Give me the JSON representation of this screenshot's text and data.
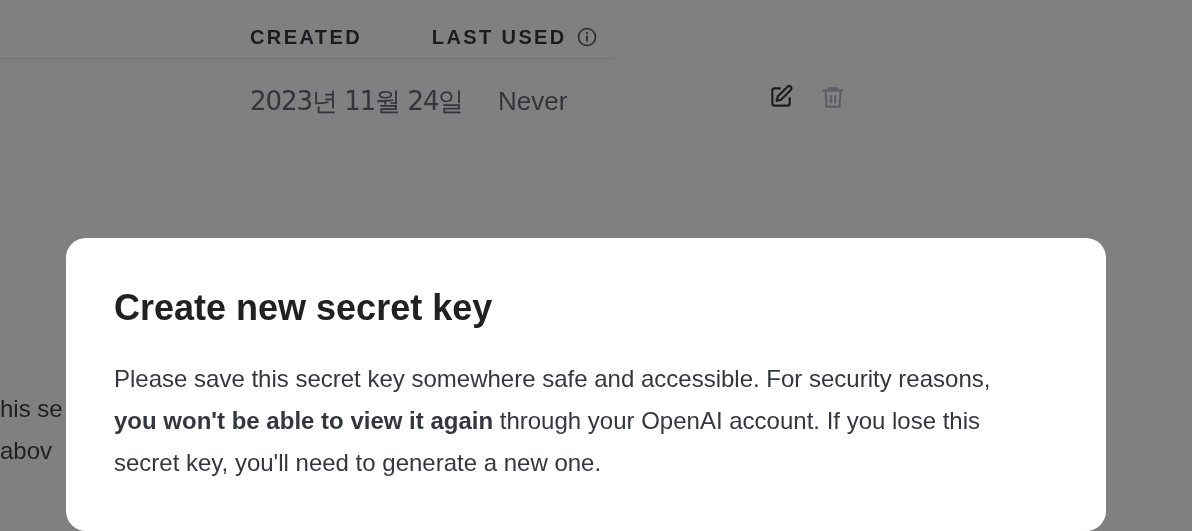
{
  "table": {
    "columns": [
      {
        "label": "CREATED",
        "info": false
      },
      {
        "label": "LAST USED",
        "info": true
      }
    ],
    "rows": [
      {
        "created": "2023년 11월 24일",
        "last_used": "Never"
      }
    ]
  },
  "background_text": [
    "his se",
    "abov"
  ],
  "modal": {
    "title": "Create new secret key",
    "message": "Please save this secret key somewhere safe and accessible. For security reasons, **you won't be able to view it again** through your OpenAI account. If you lose this secret key, you'll need to generate a new one."
  }
}
